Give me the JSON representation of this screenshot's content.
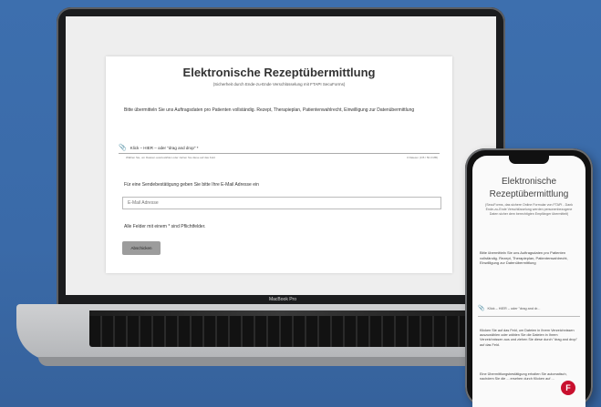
{
  "desktop": {
    "form": {
      "title": "Elektronische Rezeptübermittlung",
      "subtitle": "(Sicherheit durch Ende-zu-Ende Verschlüsselung mit FTAPI SecuForms)",
      "intro": "Bitte übermitteln Sie uns Auftragsdaten pro Patienten vollständig. Rezept, Therapieplan, Patientenwahlrecht, Einwilligung zur Datenübermittlung",
      "file_prompt": "Klick – HIER – oder \"drag and drop\" *",
      "file_hint": "Wählen Sie, um Dateien auszuwählen oder ziehen Sie diese auf das Feld",
      "file_count": "0 Dateien (0 B / 50.0 MB)",
      "email_label": "Für eine Sendebestätigung geben Sie bitte Ihre E-Mail Adresse ein",
      "email_placeholder": "E-Mail Adresse",
      "required_note": "Alle Felder mit einem * sind Pflichtfelder.",
      "submit_label": "Abschicken"
    },
    "device_label": "MacBook Pro"
  },
  "mobile": {
    "title": "Elektronische Rezeptübermittlung",
    "subtitle": "(SecuForms, das sichere Online Formular von FTAPI - Dank Ende-zu-Ende Verschlüsselung werden personenbezogene Daten sicher dem berechtigten Empfänger übermittelt)",
    "intro": "Bitte übermitteln Sie uns Auftragsdaten pro Patienten vollständig. Rezept, Therapieplan, Patientenwahlrecht, Einwilligung zur Datenübermittlung",
    "file_prompt": "Klick – HIER – oder \"drag and dr...",
    "hint": "Klicken Sie auf das Feld, um Dateien in Ihrem Verzeichnissen auszuwählen oder wählen Sie die Dateien in Ihrem Verzeichnissen aus und ziehen Sie diese durch \"drag and drop\" auf das Feld.",
    "confirm": "Eine Übermittlungsbestätigung erhalten Sie automatisch, nachdem Sie die ... ersehen durch Klicken auf ...",
    "badge_label": "F"
  }
}
